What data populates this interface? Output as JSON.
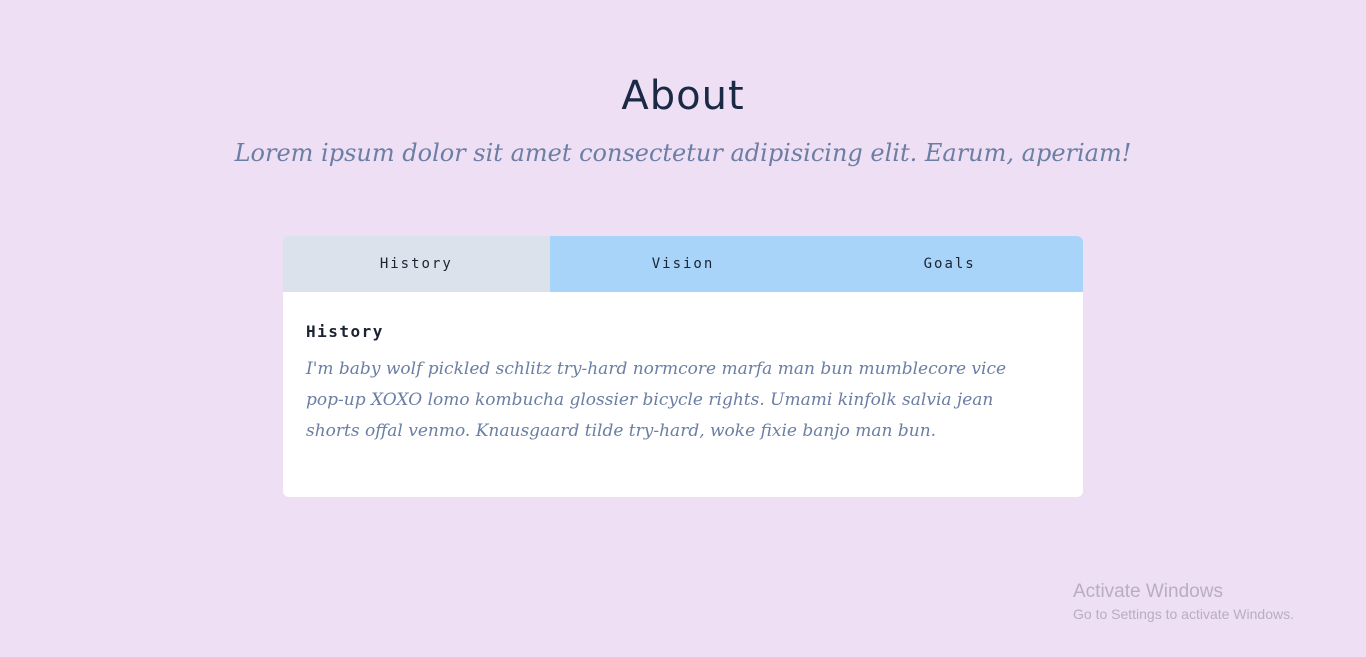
{
  "header": {
    "title": "About",
    "subtitle": "Lorem ipsum dolor sit amet consectetur adipisicing elit. Earum, aperiam!"
  },
  "tabs": {
    "active_index": 0,
    "items": [
      {
        "label": "History"
      },
      {
        "label": "Vision"
      },
      {
        "label": "Goals"
      }
    ]
  },
  "content": {
    "title": "History",
    "body": "I'm baby wolf pickled schlitz try-hard normcore marfa man bun mumblecore vice pop-up XOXO lomo kombucha glossier bicycle rights. Umami kinfolk salvia jean shorts offal venmo. Knausgaard tilde try-hard, woke fixie banjo man bun."
  },
  "watermark": {
    "title": "Activate Windows",
    "subtitle": "Go to Settings to activate Windows."
  },
  "colors": {
    "background": "#efdff5",
    "tab_bar": "#a7d4f8",
    "active_tab": "#dbe2ec",
    "card": "#ffffff",
    "heading": "#1b2a44",
    "body_text": "#6b7ea3"
  }
}
